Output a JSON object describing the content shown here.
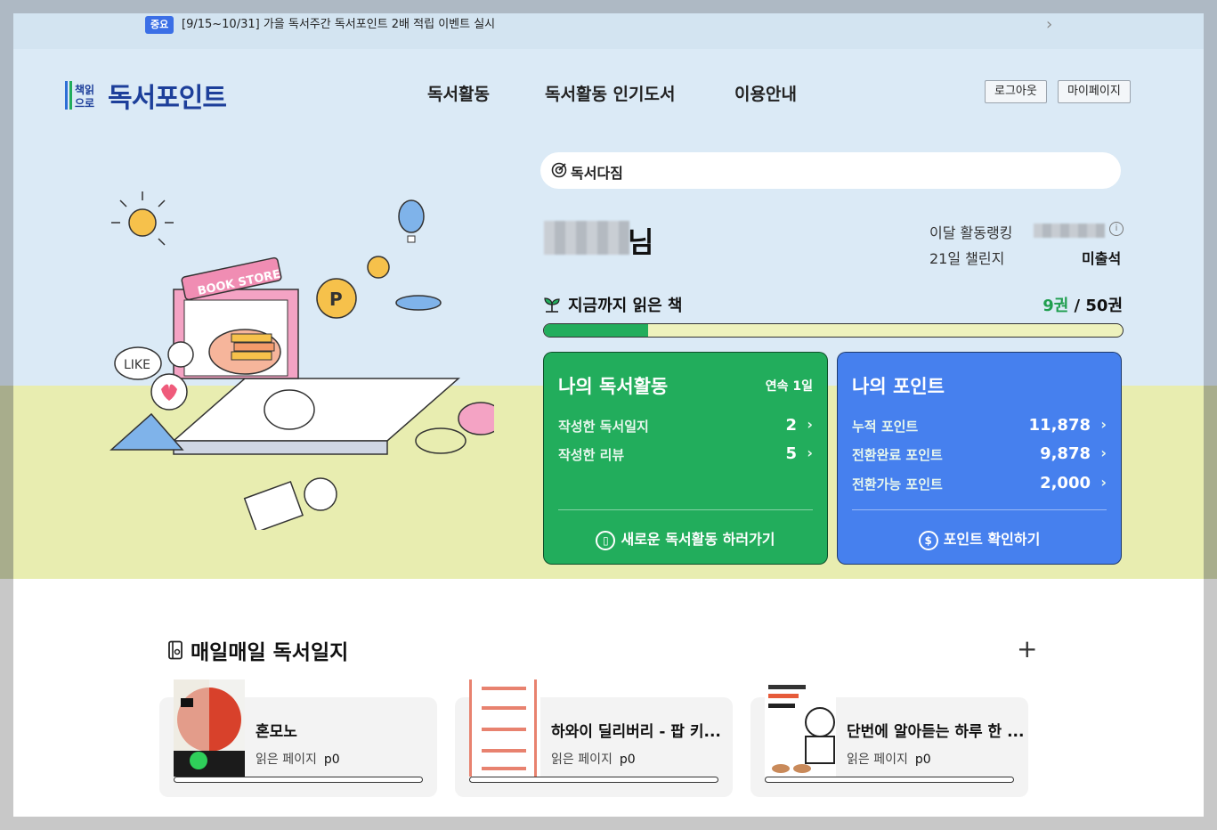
{
  "notice": {
    "badge": "중요",
    "text": "[9/15~10/31] 가을 독서주간 독서포인트 2배 적립 이벤트 실시"
  },
  "brand": {
    "logo_mark": "책읽는 으로",
    "name": "독서포인트"
  },
  "nav": {
    "items": [
      "독서활동",
      "독서활동 인기도서",
      "이용안내"
    ]
  },
  "header_buttons": {
    "logout": "로그아웃",
    "mypage": "마이페이지"
  },
  "resolution": {
    "label": "독서다짐"
  },
  "profile": {
    "suffix": "님",
    "rank_label": "이달 활동랭킹",
    "challenge_label": "21일 챌린지",
    "challenge_value": "미출석"
  },
  "reading": {
    "label": "지금까지 읽은 책",
    "count": "9권",
    "sep": " / ",
    "goal": "50권",
    "progress": 0.18
  },
  "activity_card": {
    "title": "나의 독서활동",
    "streak": "연속 1일",
    "rows": [
      {
        "label": "작성한 독서일지",
        "value": "2"
      },
      {
        "label": "작성한 리뷰",
        "value": "5"
      }
    ],
    "cta": "새로운 독서활동 하러가기"
  },
  "point_card": {
    "title": "나의 포인트",
    "rows": [
      {
        "label": "누적 포인트",
        "value": "11,878"
      },
      {
        "label": "전환완료 포인트",
        "value": "9,878"
      },
      {
        "label": "전환가능 포인트",
        "value": "2,000"
      }
    ],
    "cta": "포인트 확인하기"
  },
  "journal": {
    "title": "매일매일 독서일지",
    "pages_label": "읽은 페이지",
    "items": [
      {
        "title": "혼모노",
        "pages": "p0",
        "progress": 0
      },
      {
        "title": "하와이 딜리버리 - 팝 키...",
        "pages": "p0",
        "progress": 0
      },
      {
        "title": "단번에 알아듣는 하루 한 ...",
        "pages": "p0",
        "progress": 0
      }
    ]
  },
  "colors": {
    "green": "#22ad5c",
    "blue": "#4680ee",
    "brand": "#1d3f9a",
    "sky": "#dbeaf6",
    "grass": "#e8edb0"
  },
  "icons": [
    "chevron-right-icon",
    "target-icon",
    "sprout-icon",
    "book-icon",
    "coin-icon",
    "info-icon",
    "plus-icon",
    "journal-icon",
    "hero-illustration"
  ]
}
